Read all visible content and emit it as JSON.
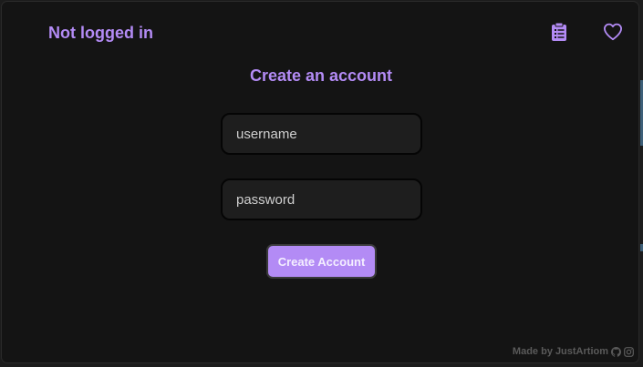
{
  "status": {
    "label": "Not logged in"
  },
  "header_icons": {
    "clipboard": "clipboard-list-icon",
    "favorites": "heart-outline-icon"
  },
  "form": {
    "heading": "Create an account",
    "username_placeholder": "username",
    "username_value": "",
    "password_placeholder": "password",
    "password_value": "",
    "submit_label": "Create Account"
  },
  "footer": {
    "prefix": "Made by ",
    "author": "JustArtiom",
    "icons": [
      "github-icon",
      "instagram-icon"
    ]
  },
  "colors": {
    "accent": "#b38bf5",
    "background": "#141414",
    "field_background": "#1e1e1e",
    "footer_text": "#5a5a5a"
  }
}
